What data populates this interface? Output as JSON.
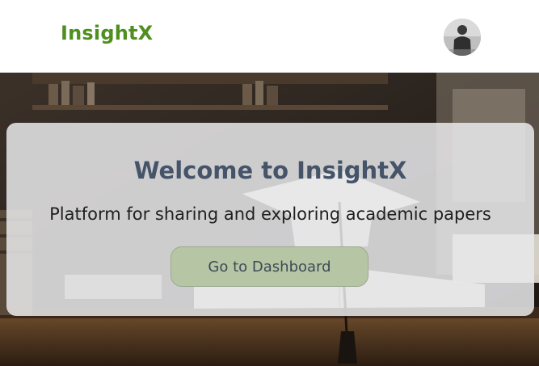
{
  "header": {
    "brand": "InsightX",
    "avatar_icon": "user-avatar-icon"
  },
  "hero": {
    "background_icon": "library-books-graduation-cap-photo",
    "title": "Welcome to InsightX",
    "subtitle": "Platform for sharing and exploring academic papers",
    "cta_label": "Go to Dashboard"
  },
  "colors": {
    "brand": "#4e8f1e",
    "title": "#455469",
    "button_bg": "#b6c6a4",
    "card_bg": "#e9e9eb"
  }
}
